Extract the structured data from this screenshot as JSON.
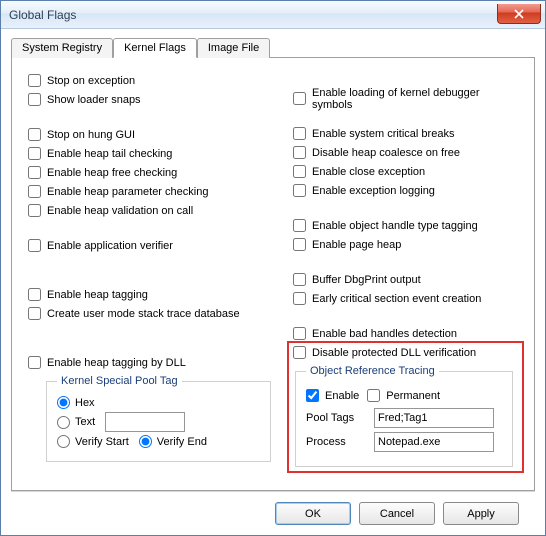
{
  "window": {
    "title": "Global Flags"
  },
  "tabs": {
    "system_registry": "System Registry",
    "kernel_flags": "Kernel Flags",
    "image_file": "Image File",
    "active": "kernel_flags"
  },
  "left": {
    "stop_on_exception": "Stop on exception",
    "show_loader_snaps": "Show loader snaps",
    "stop_on_hung_gui": "Stop on hung GUI",
    "enable_heap_tail": "Enable heap tail checking",
    "enable_heap_free": "Enable heap free checking",
    "enable_heap_param": "Enable heap parameter checking",
    "enable_heap_val": "Enable heap validation on call",
    "enable_app_verifier": "Enable application verifier",
    "enable_heap_tagging": "Enable heap tagging",
    "create_stack_trace": "Create user mode stack trace database",
    "enable_heap_tag_dll": "Enable heap tagging by DLL"
  },
  "right": {
    "enable_loading_kernel_dbg": "Enable loading of kernel debugger symbols",
    "enable_sys_crit": "Enable system critical breaks",
    "disable_heap_coalesce": "Disable heap coalesce on free",
    "enable_close_exc": "Enable close exception",
    "enable_exc_logging": "Enable exception logging",
    "enable_obj_handle": "Enable object handle type tagging",
    "enable_page_heap": "Enable page heap",
    "buffer_dbgprint": "Buffer DbgPrint output",
    "early_crit_section": "Early critical section event creation",
    "enable_bad_handles": "Enable bad handles detection",
    "disable_protected_dll": "Disable protected DLL verification"
  },
  "kspt": {
    "legend": "Kernel Special Pool Tag",
    "hex": "Hex",
    "text": "Text",
    "verify_start": "Verify Start",
    "verify_end": "Verify End",
    "value": ""
  },
  "ort": {
    "legend": "Object Reference Tracing",
    "enable": "Enable",
    "permanent": "Permanent",
    "pool_tags_label": "Pool Tags",
    "pool_tags_value": "Fred;Tag1",
    "process_label": "Process",
    "process_value": "Notepad.exe"
  },
  "buttons": {
    "ok": "OK",
    "cancel": "Cancel",
    "apply": "Apply"
  }
}
